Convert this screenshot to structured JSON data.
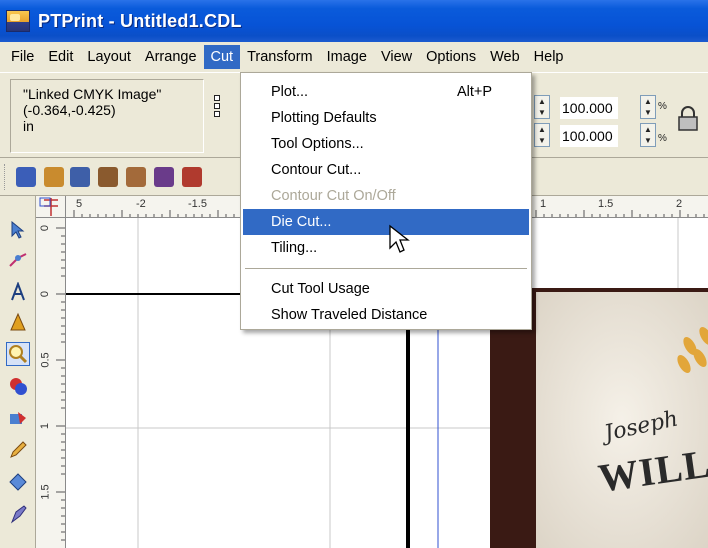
{
  "window": {
    "title": "PTPrint - Untitled1.CDL",
    "app_icon": "ptprint-app-icon"
  },
  "menubar": {
    "items": [
      {
        "label": "File"
      },
      {
        "label": "Edit"
      },
      {
        "label": "Layout"
      },
      {
        "label": "Arrange"
      },
      {
        "label": "Cut"
      },
      {
        "label": "Transform"
      },
      {
        "label": "Image"
      },
      {
        "label": "View"
      },
      {
        "label": "Options"
      },
      {
        "label": "Web"
      },
      {
        "label": "Help"
      }
    ],
    "active_index": 4
  },
  "property_bar": {
    "object_name": "\"Linked CMYK Image\"",
    "position": "(-0.364,-0.425)",
    "units": "in",
    "scale_x": "100.000",
    "scale_y": "100.000",
    "percent_symbol": "%"
  },
  "cut_menu": {
    "items": [
      {
        "label": "Plot...",
        "shortcut": "Alt+P",
        "enabled": true
      },
      {
        "label": "Plotting Defaults",
        "enabled": true
      },
      {
        "label": "Tool Options...",
        "enabled": true
      },
      {
        "label": "Contour Cut...",
        "enabled": true
      },
      {
        "label": "Contour Cut On/Off",
        "enabled": false
      },
      {
        "label": "Die Cut...",
        "enabled": true,
        "highlighted": true
      },
      {
        "label": "Tiling...",
        "enabled": true
      },
      {
        "label": "Cut Tool Usage",
        "enabled": true
      },
      {
        "label": "Show Traveled Distance",
        "enabled": true
      }
    ]
  },
  "ruler_top": {
    "labels": [
      "5",
      "-2",
      "-1.5",
      "1",
      "1.5",
      "2"
    ]
  },
  "ruler_left": {
    "labels": [
      "0",
      "0",
      "0.5",
      "1",
      "1.5"
    ]
  },
  "canvas_text": {
    "script": "Joseph",
    "wordmark": "WILLI"
  },
  "colors": {
    "title_bar": "#0A5BDB",
    "menu_highlight": "#316AC5",
    "chrome": "#ECE9D8"
  }
}
